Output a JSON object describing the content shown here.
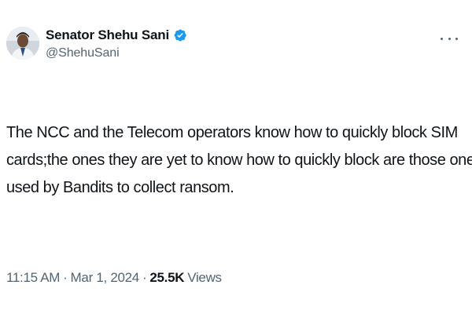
{
  "author": {
    "name": "Senator Shehu Sani",
    "handle": "@ShehuSani",
    "verified_color": "#1d9bf0"
  },
  "tweet": {
    "text_lines": [
      "The NCC and the Telecom operators know how to quickly block SIM",
      "cards;the ones they are yet to know how to quickly block are those ones",
      "used by Bandits to collect ransom."
    ]
  },
  "meta": {
    "time": "11:15 AM",
    "separator": "·",
    "date": "Mar 1, 2024",
    "views_count": "25.5K",
    "views_label": "Views"
  },
  "icons": {
    "more": "more-options-icon",
    "verified": "verified-badge-icon"
  }
}
